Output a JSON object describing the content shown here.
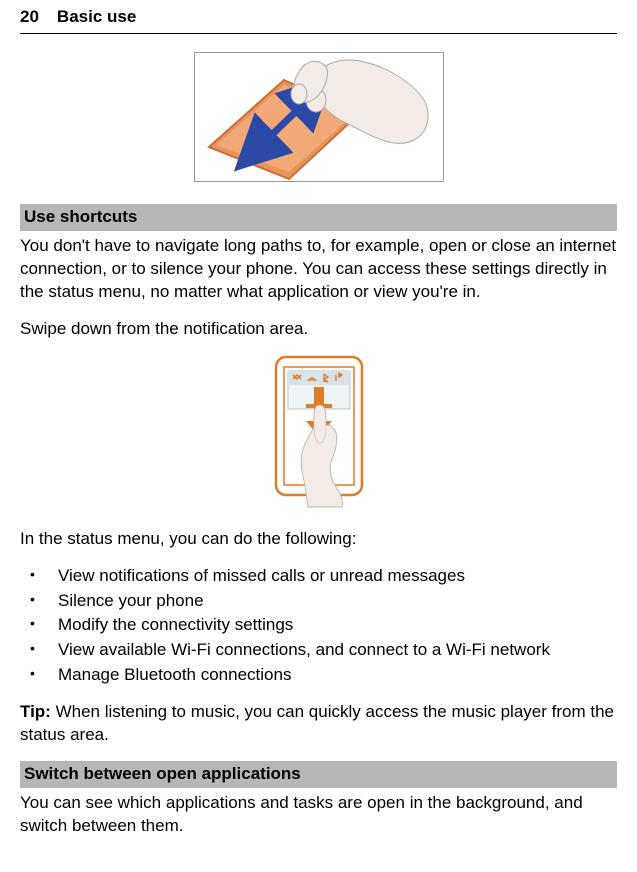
{
  "header": {
    "page_number": "20",
    "chapter_title": "Basic use"
  },
  "section1": {
    "title": "Use shortcuts",
    "paragraph1": "You don't have to navigate long paths to, for example, open or close an internet connection, or to silence your phone. You can access these settings directly in the status menu, no matter what application or view you're in.",
    "paragraph2": "Swipe down from the notification area.",
    "lead_in": "In the status menu, you can do the following:",
    "bullets": {
      "b0": "View notifications of missed calls or unread messages",
      "b1": "Silence your phone",
      "b2": "Modify the connectivity settings",
      "b3": "View available Wi-Fi connections, and connect to a Wi-Fi network",
      "b4": "Manage Bluetooth connections"
    },
    "tip_label": "Tip: ",
    "tip_text": "When listening to music, you can quickly access the music player from the status area."
  },
  "section2": {
    "title": "Switch between open applications",
    "paragraph1": "You can see which applications and tasks are open in the background, and switch between them."
  }
}
